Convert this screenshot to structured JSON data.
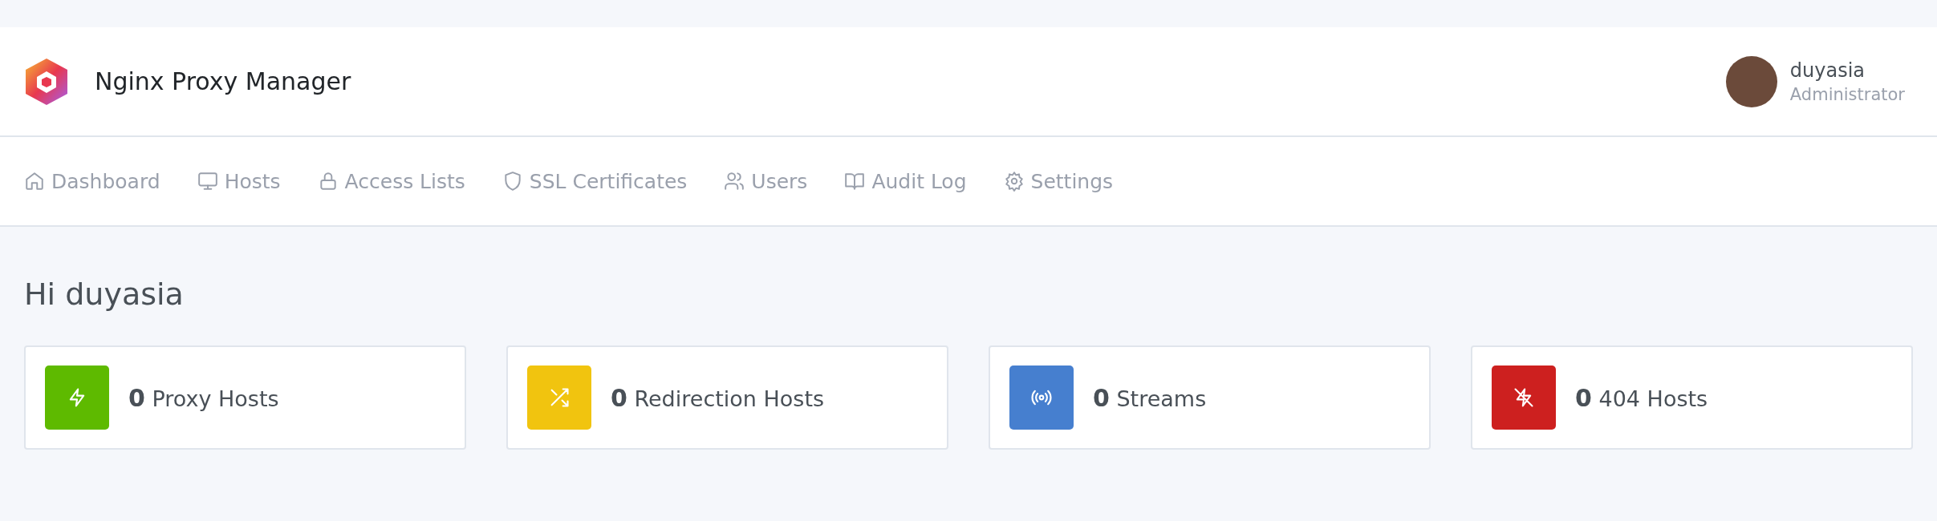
{
  "header": {
    "app_name": "Nginx Proxy Manager",
    "user": {
      "name": "duyasia",
      "role": "Administrator"
    }
  },
  "nav": [
    {
      "label": "Dashboard",
      "kind": "home"
    },
    {
      "label": "Hosts",
      "kind": "monitor"
    },
    {
      "label": "Access Lists",
      "kind": "lock"
    },
    {
      "label": "SSL Certificates",
      "kind": "shield"
    },
    {
      "label": "Users",
      "kind": "users"
    },
    {
      "label": "Audit Log",
      "kind": "book"
    },
    {
      "label": "Settings",
      "kind": "gear"
    }
  ],
  "greeting": "Hi duyasia",
  "stats": [
    {
      "count": "0",
      "label": "Proxy Hosts",
      "kind": "bolt",
      "color": "#5eba00"
    },
    {
      "count": "0",
      "label": "Redirection Hosts",
      "kind": "shuffle",
      "color": "#f1c40f"
    },
    {
      "count": "0",
      "label": "Streams",
      "kind": "radio",
      "color": "#467fcf"
    },
    {
      "count": "0",
      "label": "404 Hosts",
      "kind": "bolt-off",
      "color": "#cd201f"
    }
  ]
}
